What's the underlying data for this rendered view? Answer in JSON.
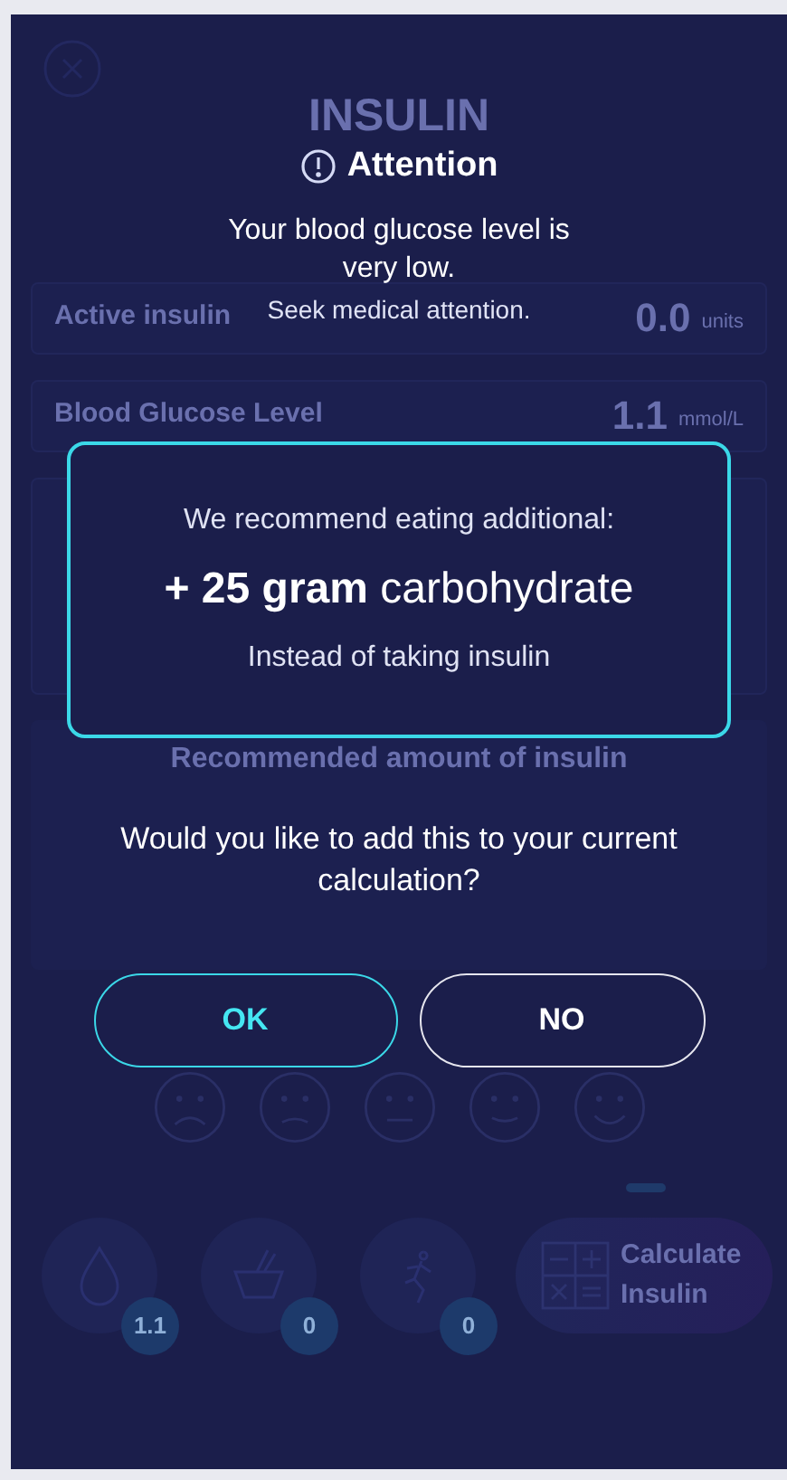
{
  "background": {
    "title": "INSULIN",
    "cards": [
      {
        "label": "Active insulin",
        "value": "0.0",
        "unit": "units"
      },
      {
        "label": "Blood Glucose Level",
        "value": "1.1",
        "unit": "mmol/L"
      }
    ],
    "recommended_title": "Recommended amount of insulin",
    "badges": [
      "1.1",
      "0",
      "0"
    ],
    "calculate_button": "Calculate Insulin"
  },
  "dialog": {
    "title": "Attention",
    "message": "Your blood glucose level is very low.",
    "note": "Seek medical attention.",
    "recommendation": {
      "intro": "We recommend eating additional:",
      "amount": "**+ 25 gram** carbohydrate",
      "note": "Instead of taking insulin"
    },
    "question": "Would you like to add this to your current calculation?",
    "buttons": [
      {
        "label": "OK",
        "kind": "primary"
      },
      {
        "label": "NO",
        "kind": "secondary"
      }
    ]
  }
}
